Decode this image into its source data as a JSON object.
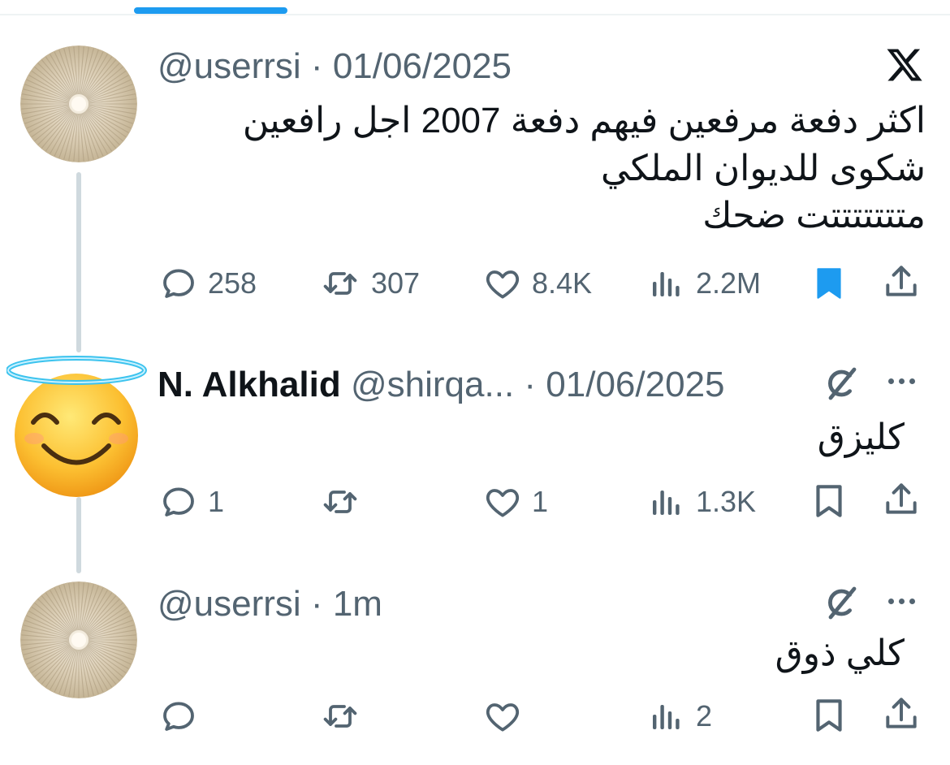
{
  "tweets": [
    {
      "handle": "@userrsi",
      "separator": "·",
      "date": "01/06/2025",
      "text_lines": [
        "اكثر دفعة مرفعين فيهم دفعة 2007 اجل رافعين",
        "شكوى للديوان الملكي",
        "متتتتتتتت ضحك"
      ],
      "replies": "258",
      "reposts": "307",
      "likes": "8.4K",
      "views": "2.2M",
      "bookmarked": true
    },
    {
      "name": "N. Alkhalid",
      "handle": "@shirqa...",
      "separator": "·",
      "date": "01/06/2025",
      "text": "كليزق",
      "replies": "1",
      "reposts": "",
      "likes": "1",
      "views": "1.3K",
      "bookmarked": false
    },
    {
      "handle": "@userrsi",
      "separator": "·",
      "date": "1m",
      "text": "كلي ذوق",
      "replies": "",
      "reposts": "",
      "likes": "",
      "views": "2",
      "bookmarked": false
    }
  ],
  "colors": {
    "accent": "#1d9bf0",
    "text_primary": "#0f1419",
    "text_secondary": "#536471",
    "thread_line": "#cfd9de"
  },
  "icons": [
    "x-logo-icon",
    "reply-icon",
    "repost-icon",
    "like-icon",
    "views-icon",
    "bookmark-icon",
    "share-icon",
    "grok-icon",
    "more-icon"
  ]
}
